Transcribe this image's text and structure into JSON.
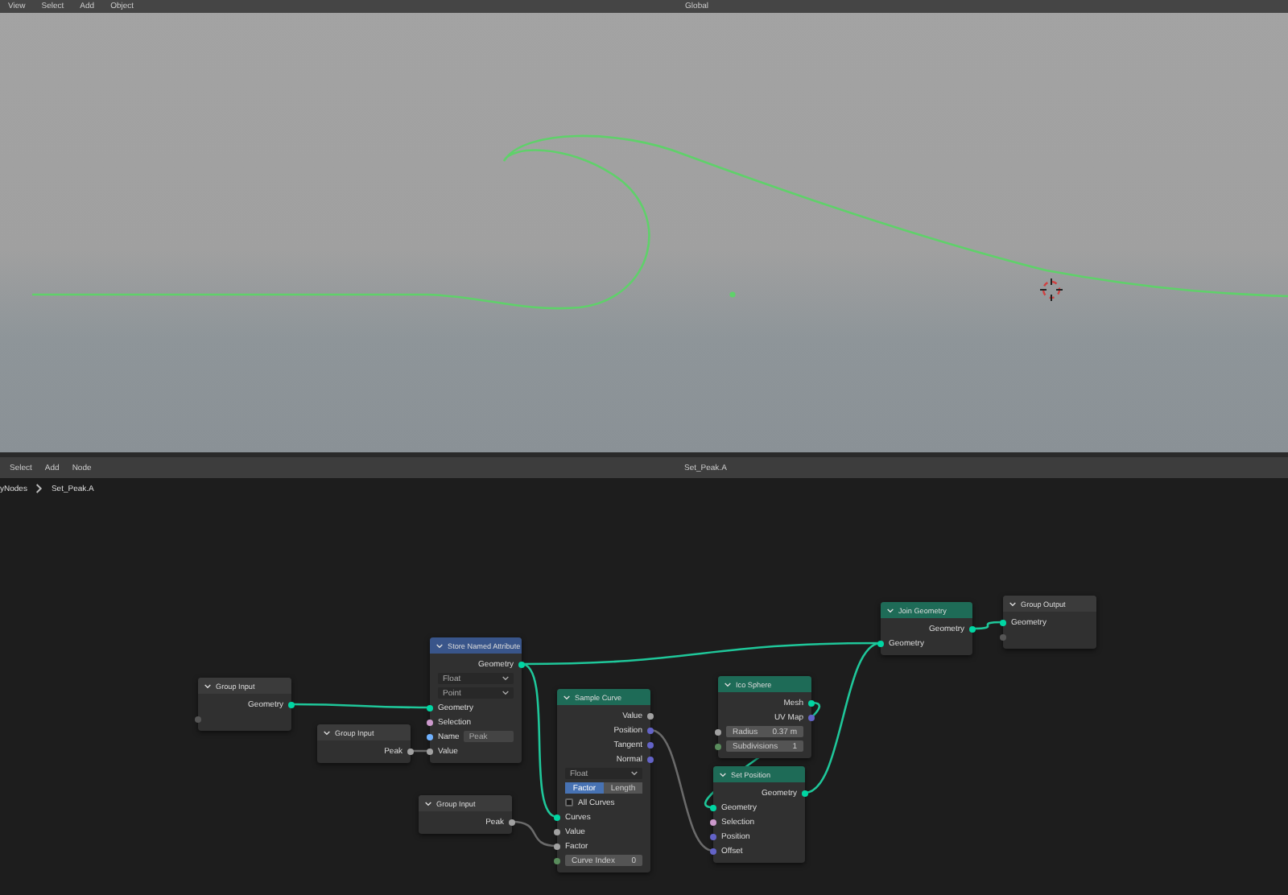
{
  "viewport": {
    "menu": [
      "View",
      "Select",
      "Add",
      "Object"
    ],
    "orientation": "Global"
  },
  "node_editor": {
    "menu": [
      "Select",
      "Add",
      "Node"
    ],
    "tree_name": "Set_Peak.A",
    "breadcrumb": [
      "yNodes",
      "Set_Peak.A"
    ]
  },
  "nodes": [
    {
      "title": "Group Input",
      "kind": "group",
      "rows": [
        {
          "kind": "output",
          "label": "Geometry",
          "color": "#00d6a3"
        },
        {
          "kind": "socket",
          "color": "#555555"
        }
      ]
    },
    {
      "title": "Group Input",
      "kind": "group",
      "rows": [
        {
          "kind": "output",
          "label": "Peak",
          "color": "#a1a1a1"
        }
      ]
    },
    {
      "title": "Store Named Attribute",
      "kind": "attribute",
      "rows": [
        {
          "kind": "output",
          "label": "Geometry",
          "color": "#00d6a3"
        },
        {
          "kind": "dropdown",
          "label": "Float"
        },
        {
          "kind": "dropdown",
          "label": "Point"
        },
        {
          "kind": "input",
          "label": "Geometry",
          "color": "#00d6a3"
        },
        {
          "kind": "input",
          "label": "Selection",
          "color": "#cc99cc"
        },
        {
          "kind": "field",
          "label": "Name",
          "value": "Peak",
          "color": "#70b2ff"
        },
        {
          "kind": "input",
          "label": "Value",
          "color": "#a1a1a1"
        }
      ]
    },
    {
      "title": "Group Input",
      "kind": "group",
      "rows": [
        {
          "kind": "output",
          "label": "Peak",
          "color": "#a1a1a1"
        }
      ]
    },
    {
      "title": "Sample Curve",
      "kind": "geometry",
      "rows": [
        {
          "kind": "output",
          "label": "Value",
          "color": "#a1a1a1"
        },
        {
          "kind": "output",
          "label": "Position",
          "color": "#6363c7"
        },
        {
          "kind": "output",
          "label": "Tangent",
          "color": "#6363c7"
        },
        {
          "kind": "output",
          "label": "Normal",
          "color": "#6363c7"
        },
        {
          "kind": "dropdown",
          "label": "Float"
        },
        {
          "kind": "toggle",
          "options": [
            {
              "label": "Factor",
              "selected": true
            },
            {
              "label": "Length",
              "selected": false
            }
          ]
        },
        {
          "kind": "checkbox",
          "label": "All Curves",
          "checked": false
        },
        {
          "kind": "input",
          "label": "Curves",
          "color": "#00d6a3"
        },
        {
          "kind": "input",
          "label": "Value",
          "color": "#a1a1a1"
        },
        {
          "kind": "input",
          "label": "Factor",
          "color": "#a1a1a1"
        },
        {
          "kind": "slider",
          "label": "Curve Index",
          "value": "0",
          "color": "#598c5c"
        }
      ]
    },
    {
      "title": "Ico Sphere",
      "kind": "geometry",
      "rows": [
        {
          "kind": "output",
          "label": "Mesh",
          "color": "#00d6a3"
        },
        {
          "kind": "output",
          "label": "UV Map",
          "color": "#6363c7"
        },
        {
          "kind": "slider",
          "label": "Radius",
          "value": "0.37 m",
          "color": "#a1a1a1"
        },
        {
          "kind": "slider",
          "label": "Subdivisions",
          "value": "1",
          "color": "#598c5c"
        }
      ]
    },
    {
      "title": "Set Position",
      "kind": "geometry",
      "rows": [
        {
          "kind": "output",
          "label": "Geometry",
          "color": "#00d6a3"
        },
        {
          "kind": "input",
          "label": "Geometry",
          "color": "#00d6a3"
        },
        {
          "kind": "input",
          "label": "Selection",
          "color": "#cc99cc"
        },
        {
          "kind": "input",
          "label": "Position",
          "color": "#6363c7"
        },
        {
          "kind": "input",
          "label": "Offset",
          "color": "#6363c7"
        }
      ]
    },
    {
      "title": "Join Geometry",
      "kind": "geometry",
      "rows": [
        {
          "kind": "output",
          "label": "Geometry",
          "color": "#00d6a3"
        },
        {
          "kind": "input",
          "label": "Geometry",
          "color": "#00d6a3"
        }
      ]
    },
    {
      "title": "Group Output",
      "kind": "group",
      "rows": [
        {
          "kind": "input",
          "label": "Geometry",
          "color": "#00d6a3"
        },
        {
          "kind": "socket",
          "color": "#555555"
        }
      ]
    }
  ]
}
